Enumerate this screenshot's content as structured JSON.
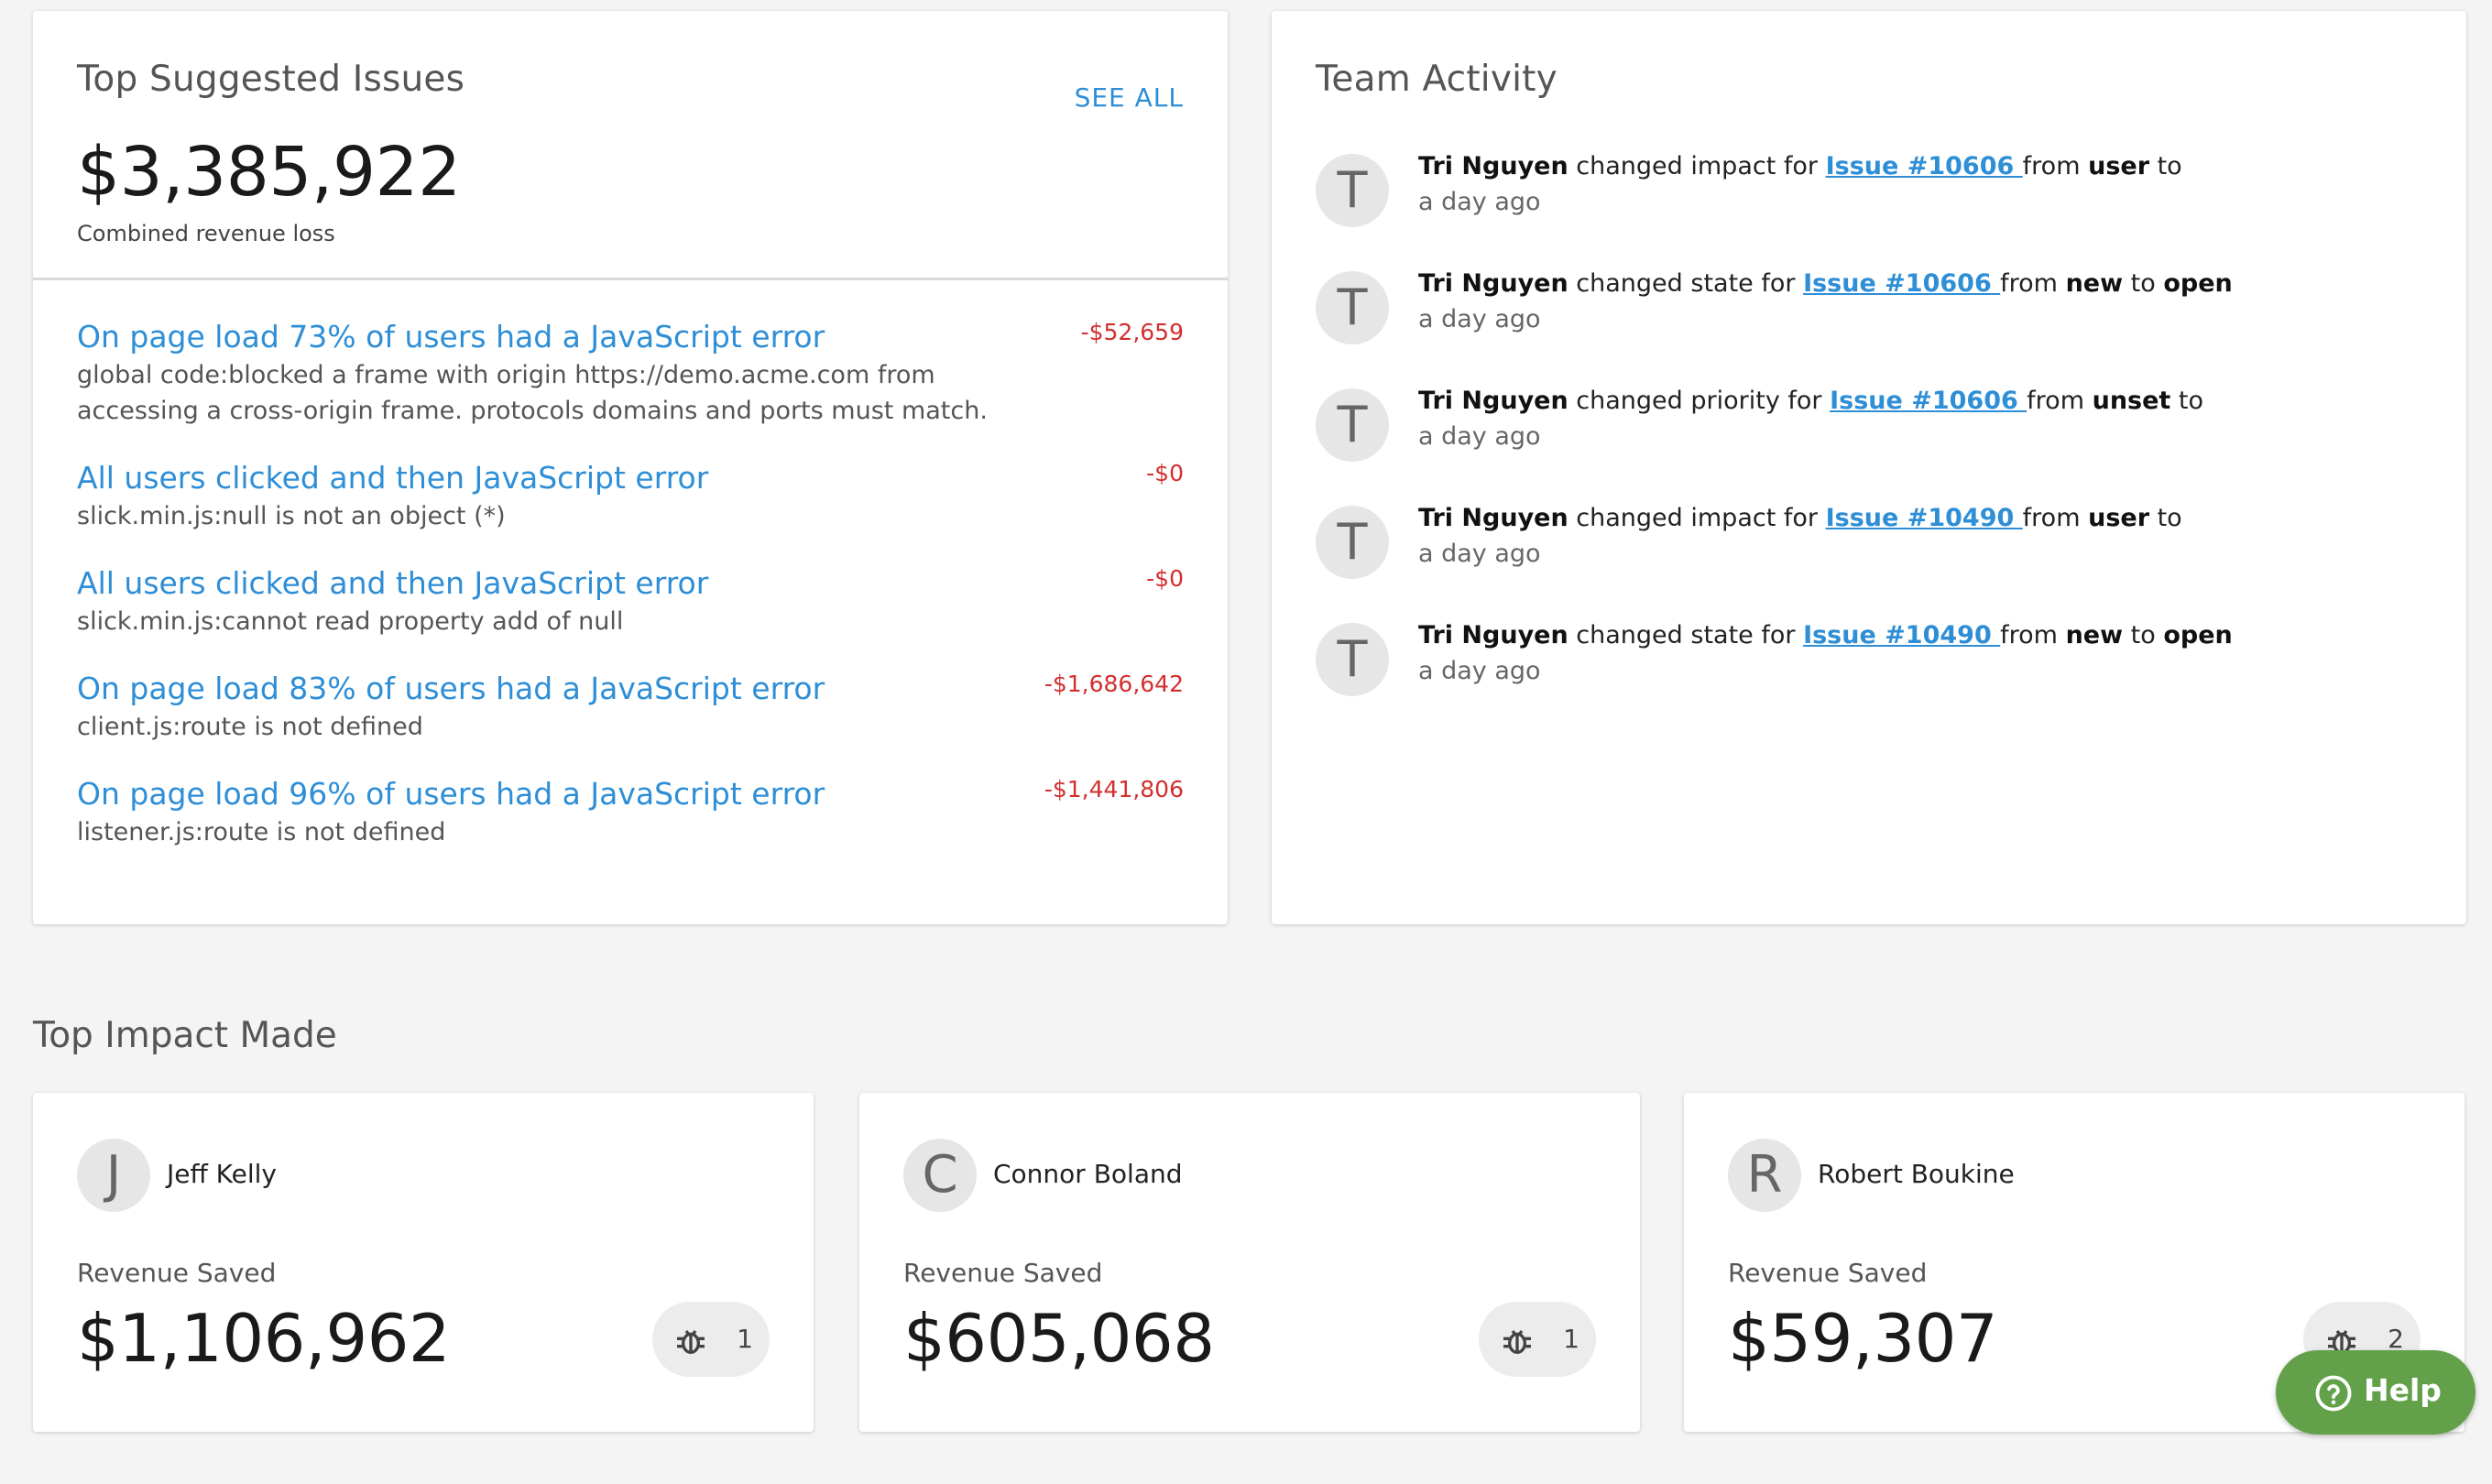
{
  "issues_card": {
    "title": "Top Suggested Issues",
    "see_all": "SEE ALL",
    "total": "$3,385,922",
    "total_caption": "Combined revenue loss",
    "items": [
      {
        "title": "On page load 73% of users had a JavaScript error",
        "desc": "global code:blocked a frame with origin https://demo.acme.com from accessing a cross-origin frame. protocols domains and ports must match.",
        "loss": "-$52,659"
      },
      {
        "title": "All users clicked and then JavaScript error",
        "desc": "slick.min.js:null is not an object (*)",
        "loss": "-$0"
      },
      {
        "title": "All users clicked and then JavaScript error",
        "desc": "slick.min.js:cannot read property add of null",
        "loss": "-$0"
      },
      {
        "title": "On page load 83% of users had a JavaScript error",
        "desc": "client.js:route is not defined",
        "loss": "-$1,686,642"
      },
      {
        "title": "On page load 96% of users had a JavaScript error",
        "desc": "listener.js:route is not defined",
        "loss": "-$1,441,806"
      }
    ]
  },
  "activity_card": {
    "title": "Team Activity",
    "items": [
      {
        "initial": "T",
        "user": "Tri Nguyen",
        "action": " changed impact for ",
        "issue": "Issue #10606 ",
        "from_word": "from ",
        "from": "user",
        "to_word": " to",
        "to_value": "",
        "time": "a day ago"
      },
      {
        "initial": "T",
        "user": "Tri Nguyen",
        "action": " changed state for ",
        "issue": "Issue #10606 ",
        "from_word": "from ",
        "from": "new",
        "to_word": " to ",
        "to_value": "open",
        "time": "a day ago"
      },
      {
        "initial": "T",
        "user": "Tri Nguyen",
        "action": " changed priority for ",
        "issue": "Issue #10606 ",
        "from_word": "from ",
        "from": "unset",
        "to_word": " to",
        "to_value": "",
        "time": "a day ago"
      },
      {
        "initial": "T",
        "user": "Tri Nguyen",
        "action": " changed impact for ",
        "issue": "Issue #10490 ",
        "from_word": "from ",
        "from": "user",
        "to_word": " to",
        "to_value": "",
        "time": "a day ago"
      },
      {
        "initial": "T",
        "user": "Tri Nguyen",
        "action": " changed state for ",
        "issue": "Issue #10490 ",
        "from_word": "from ",
        "from": "new",
        "to_word": " to ",
        "to_value": "open",
        "time": "a day ago"
      }
    ]
  },
  "impact": {
    "heading": "Top Impact Made",
    "cards": [
      {
        "initial": "J",
        "name": "Jeff Kelly",
        "label": "Revenue Saved",
        "amount": "$1,106,962",
        "bugs": "1"
      },
      {
        "initial": "C",
        "name": "Connor Boland",
        "label": "Revenue Saved",
        "amount": "$605,068",
        "bugs": "1"
      },
      {
        "initial": "R",
        "name": "Robert Boukine",
        "label": "Revenue Saved",
        "amount": "$59,307",
        "bugs": "2"
      }
    ]
  },
  "help": {
    "label": "Help",
    "icon": "question-circle-icon"
  },
  "colors": {
    "link": "#2e8ed6",
    "loss": "#d32f2f",
    "help": "#62a14a"
  }
}
